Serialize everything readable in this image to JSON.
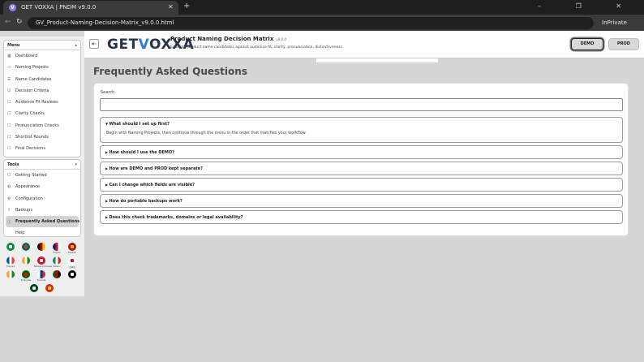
{
  "browser": {
    "tab_title": "GET VOXXA | PNDM v9.0.0",
    "tab_favicon": "V",
    "url": "GV_Product-Naming-Decision-Matrix_v9.0.0.html",
    "mode_label": "InPrivate"
  },
  "header": {
    "logo_prefix": "GET",
    "logo_accent": "V",
    "logo_suffix": "OXXA",
    "title": "Product Naming Decision Matrix",
    "version": "v9.0.0",
    "subtitle": "Evaluate product name candidates against audience fit, clarity, pronunciation, distinctiveness",
    "demo_label": "DEMO",
    "prod_label": "PROD"
  },
  "sidebar": {
    "menu": {
      "title": "Menu",
      "items": [
        {
          "label": "Dashboard",
          "icon": "grid-icon"
        },
        {
          "label": "Naming Projects",
          "icon": "folder-icon"
        },
        {
          "label": "Name Candidates",
          "icon": "list-icon"
        },
        {
          "label": "Decision Criteria",
          "icon": "checklist-icon"
        },
        {
          "label": "Audience Fit Reviews",
          "icon": "audience-icon"
        },
        {
          "label": "Clarity Checks",
          "icon": "clarity-icon"
        },
        {
          "label": "Pronunciation Checks",
          "icon": "speech-icon"
        },
        {
          "label": "Shortlist Rounds",
          "icon": "shortlist-icon"
        },
        {
          "label": "Final Decisions",
          "icon": "decision-icon"
        }
      ]
    },
    "tools": {
      "title": "Tools",
      "items": [
        {
          "label": "Getting Started",
          "icon": "compass-icon"
        },
        {
          "label": "Appearance",
          "icon": "palette-icon"
        },
        {
          "label": "Configuration",
          "icon": "gear-icon"
        },
        {
          "label": "Backups",
          "icon": "upload-icon"
        },
        {
          "label": "Frequently Asked Questions",
          "icon": "question-icon"
        },
        {
          "label": "Help",
          "icon": "help-icon"
        }
      ]
    },
    "languages": [
      {
        "label": "",
        "colors": [
          "#0c8a3e",
          "#ffffff"
        ]
      },
      {
        "label": "",
        "colors": [
          "#006a4e",
          "#f42a41"
        ]
      },
      {
        "label": "",
        "colors": [
          "#000000",
          "#dd0000",
          "#ffce00"
        ]
      },
      {
        "label": "English",
        "colors": [
          "#012169",
          "#c8102e",
          "#ffffff"
        ]
      },
      {
        "label": "Español",
        "colors": [
          "#aa151b",
          "#f1bf00"
        ]
      },
      {
        "label": "Français",
        "colors": [
          "#0055a4",
          "#ffffff",
          "#ef4135"
        ]
      },
      {
        "label": "",
        "colors": [
          "#ff9933",
          "#ffffff",
          "#138808"
        ]
      },
      {
        "label": "Bahasa Indonesia",
        "colors": [
          "#ce1126",
          "#ffffff"
        ]
      },
      {
        "label": "Italiano",
        "colors": [
          "#009246",
          "#ffffff",
          "#ce2b37"
        ]
      },
      {
        "label": "日本語",
        "colors": [
          "#ffffff",
          "#bc002d"
        ]
      },
      {
        "label": "",
        "colors": [
          "#ff9933",
          "#ffffff",
          "#138808"
        ]
      },
      {
        "label": "Português",
        "colors": [
          "#006600",
          "#ff0000"
        ]
      },
      {
        "label": "Русский",
        "colors": [
          "#ffffff",
          "#0039a6",
          "#d52b1e"
        ]
      },
      {
        "label": "",
        "colors": [
          "#006600",
          "#bb0000",
          "#000000"
        ]
      },
      {
        "label": "",
        "colors": [
          "#000000",
          "#ffffff"
        ]
      },
      {
        "label": "",
        "colors": [
          "#01411c",
          "#ffffff"
        ]
      },
      {
        "label": "",
        "colors": [
          "#de2910",
          "#ffde00"
        ]
      }
    ]
  },
  "main": {
    "page_title": "Frequently Asked Questions",
    "search_label": "Search",
    "search_value": "",
    "faqs": [
      {
        "question": "What should I set up first?",
        "expanded": true,
        "answer": "Begin with Naming Projects, then continue through the menu in the order that matches your workflow."
      },
      {
        "question": "How should I use the DEMO?",
        "expanded": false,
        "answer": ""
      },
      {
        "question": "How are DEMO and PROD kept separate?",
        "expanded": false,
        "answer": ""
      },
      {
        "question": "Can I change which fields are visible?",
        "expanded": false,
        "answer": ""
      },
      {
        "question": "How do portable backups work?",
        "expanded": false,
        "answer": ""
      },
      {
        "question": "Does this check trademarks, domains or legal availability?",
        "expanded": false,
        "answer": ""
      }
    ]
  },
  "icons": {
    "expanded_marker": "▼",
    "collapsed_marker": "▶",
    "menu_caret": "▴",
    "tools_caret": "▾"
  }
}
